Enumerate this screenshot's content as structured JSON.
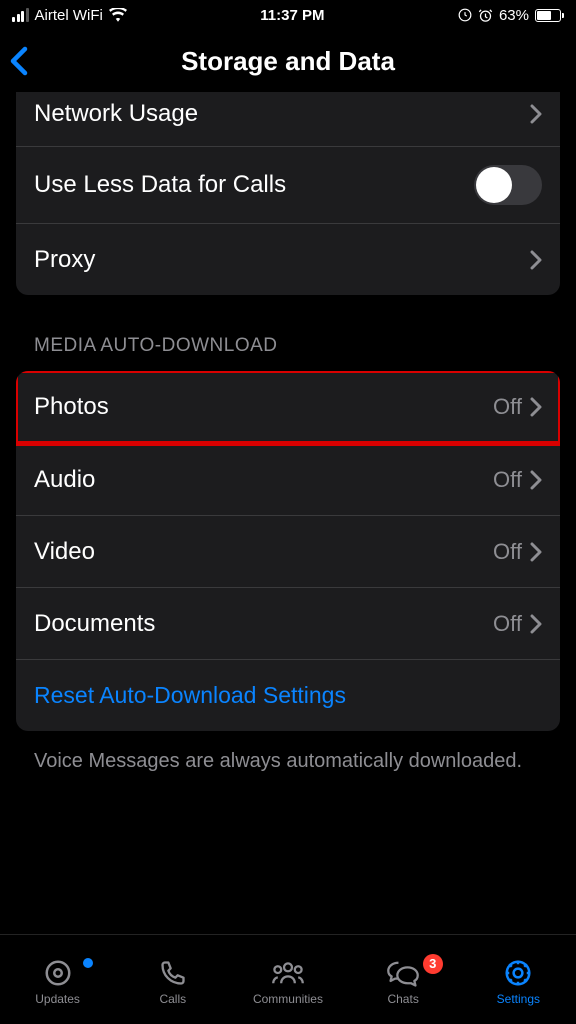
{
  "statusBar": {
    "carrier": "Airtel WiFi",
    "time": "11:37 PM",
    "batteryPercent": "63%"
  },
  "header": {
    "title": "Storage and Data"
  },
  "section1": {
    "networkUsage": "Network Usage",
    "useLessData": "Use Less Data for Calls",
    "proxy": "Proxy"
  },
  "section2": {
    "header": "MEDIA AUTO-DOWNLOAD",
    "photos": {
      "label": "Photos",
      "value": "Off"
    },
    "audio": {
      "label": "Audio",
      "value": "Off"
    },
    "video": {
      "label": "Video",
      "value": "Off"
    },
    "documents": {
      "label": "Documents",
      "value": "Off"
    },
    "reset": "Reset Auto-Download Settings"
  },
  "footer": {
    "note": "Voice Messages are always automatically downloaded."
  },
  "tabs": {
    "updates": "Updates",
    "calls": "Calls",
    "communities": "Communities",
    "chats": "Chats",
    "settings": "Settings",
    "chatsBadge": "3"
  }
}
